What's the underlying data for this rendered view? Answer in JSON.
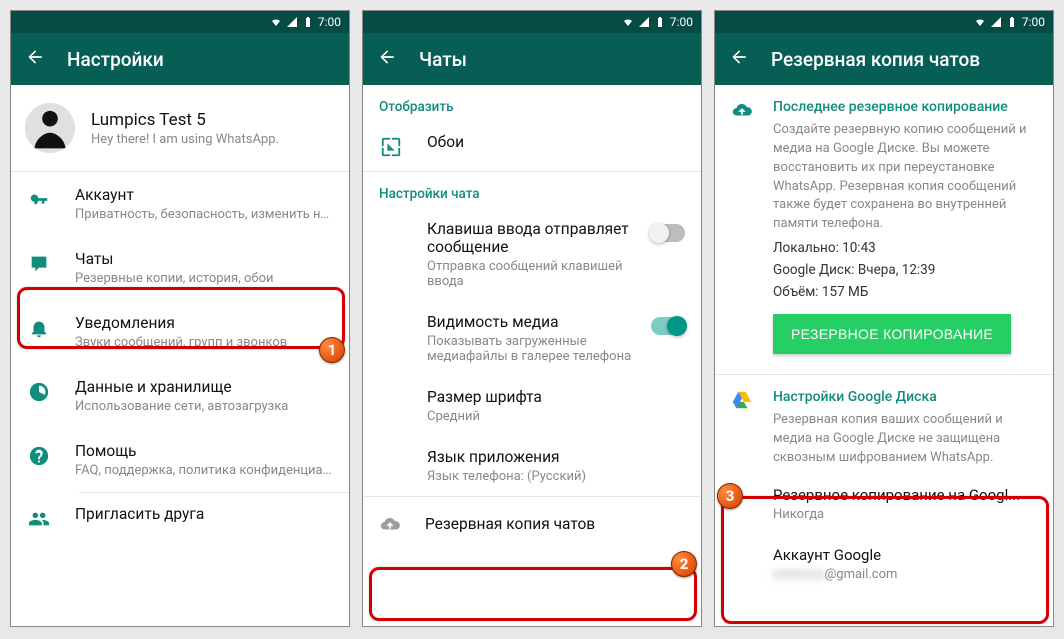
{
  "status_time": "7:00",
  "screen1": {
    "title": "Настройки",
    "profile_name": "Lumpics Test 5",
    "profile_status": "Hey there! I am using WhatsApp.",
    "items": {
      "account": {
        "title": "Аккаунт",
        "sub": "Приватность, безопасность, изменить но..."
      },
      "chats": {
        "title": "Чаты",
        "sub": "Резервные копии, история, обои"
      },
      "notif": {
        "title": "Уведомления",
        "sub": "Звуки сообщений, групп и звонков"
      },
      "data": {
        "title": "Данные и хранилище",
        "sub": "Использование сети, автозагрузка"
      },
      "help": {
        "title": "Помощь",
        "sub": "FAQ, поддержка, политика конфиденциал..."
      },
      "invite": {
        "title": "Пригласить друга"
      }
    }
  },
  "screen2": {
    "title": "Чаты",
    "section_display": "Отобразить",
    "wallpaper": "Обои",
    "section_chat_settings": "Настройки чата",
    "enter_send": {
      "title": "Клавиша ввода отправляет сообщение",
      "sub": "Отправка сообщений клавишей ввода"
    },
    "media_vis": {
      "title": "Видимость медиа",
      "sub": "Показывать загруженные медиафайлы в галерее телефона"
    },
    "font_size": {
      "title": "Размер шрифта",
      "sub": "Средний"
    },
    "app_lang": {
      "title": "Язык приложения",
      "sub": "Язык телефона: (Русский)"
    },
    "backup_row": "Резервная копия чатов"
  },
  "screen3": {
    "title": "Резервная копия чатов",
    "last_backup_title": "Последнее резервное копирование",
    "info_text": "Создайте резервную копию сообщений и медиа на Google Диске. Вы можете восстановить их при переустановке WhatsApp. Резервная копия сообщений также будет сохранена во внутренней памяти телефона.",
    "local": "Локально: 10:43",
    "gdrive_time": "Google Диск: Вчера, 12:39",
    "size": "Объём: 157 МБ",
    "backup_btn": "РЕЗЕРВНОЕ КОПИРОВАНИЕ",
    "gdrive_settings_title": "Настройки Google Диска",
    "gdrive_settings_text": "Резервная копия ваших сообщений и медиа на Google Диске не защищена сквозным шифрованием WhatsApp.",
    "backup_to_google": {
      "title": "Резервное копирование на Googl...",
      "sub": "Никогда"
    },
    "google_account": {
      "title": "Аккаунт Google",
      "sub_suffix": "@gmail.com",
      "sub_hidden": "xxxxxxxx"
    }
  },
  "badges": {
    "b1": "1",
    "b2": "2",
    "b3": "3"
  }
}
